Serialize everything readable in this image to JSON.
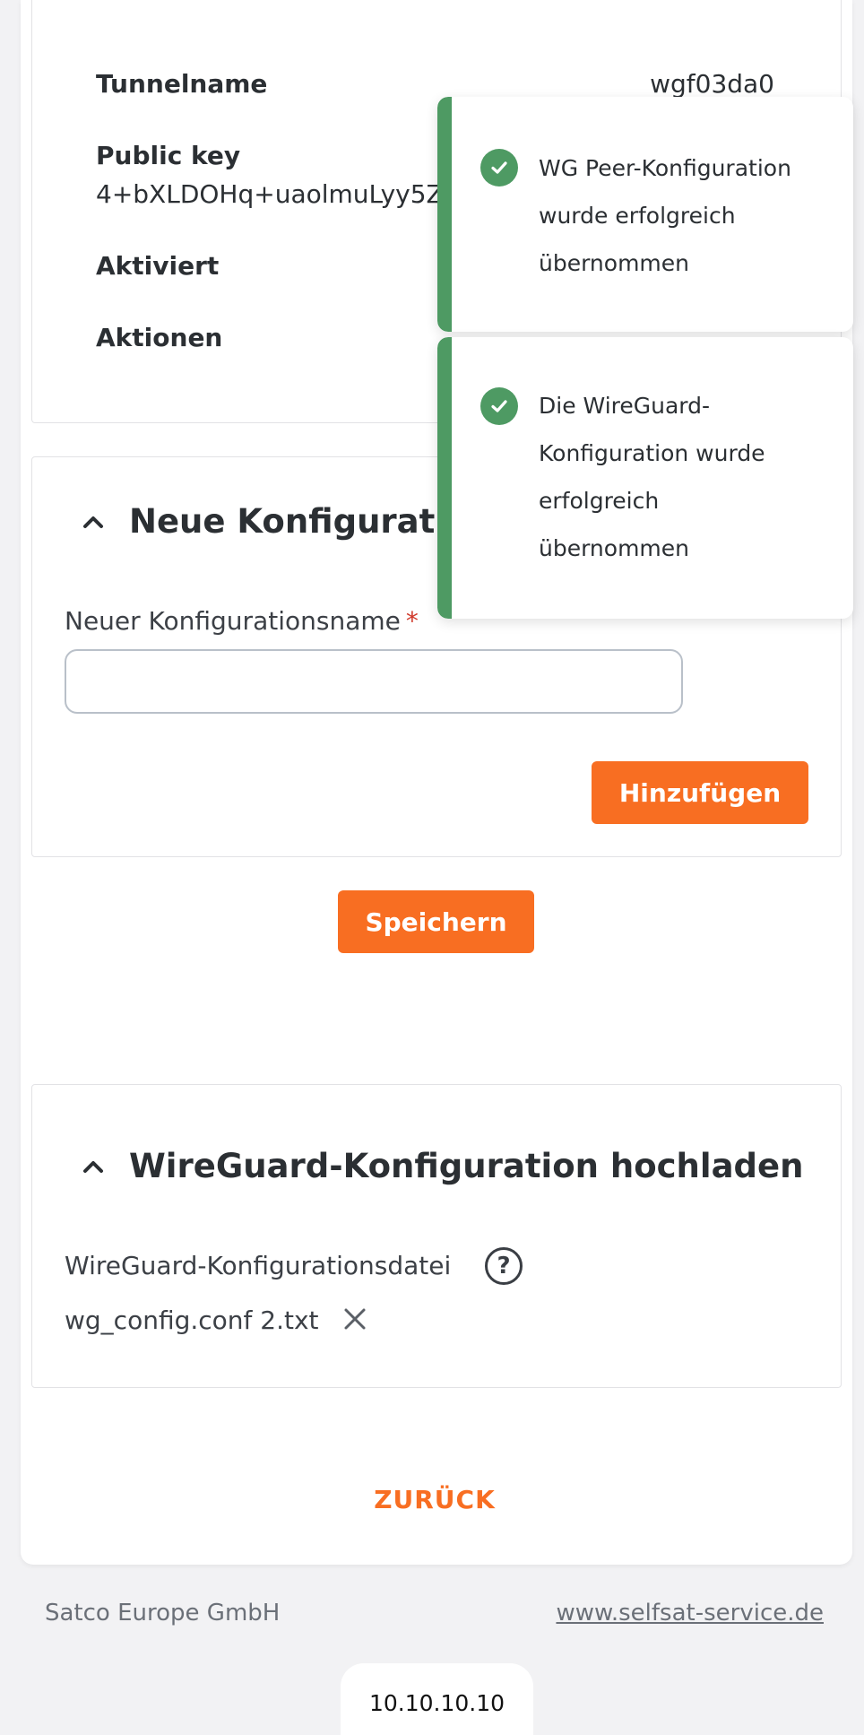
{
  "tunnel": {
    "name_label": "Tunnelname",
    "name_value": "wgf03da0",
    "public_key_label": "Public key",
    "public_key_value": "4+bXLDOHq+uaolmuLyy5Z",
    "activated_label": "Aktiviert",
    "actions_label": "Aktionen"
  },
  "new_config": {
    "title": "Neue Konfiguratio",
    "name_label": "Neuer Konfigurationsname",
    "required_mark": "*",
    "name_value": "",
    "add_button": "Hinzufügen"
  },
  "save_button": "Speichern",
  "upload": {
    "title": "WireGuard-Konfiguration hochladen",
    "file_label": "WireGuard-Konfigurationsdatei",
    "help_glyph": "?",
    "file_name": "wg_config.conf 2.txt"
  },
  "back_link": "ZURÜCK",
  "footer": {
    "company": "Satco Europe GmbH",
    "link": "www.selfsat-service.de"
  },
  "address_bar": "10.10.10.10",
  "toasts": [
    {
      "lines": [
        "WG Peer-Konfiguration",
        "wurde erfolgreich",
        "übernommen"
      ],
      "type": "success"
    },
    {
      "lines": [
        "Die WireGuard-",
        "Konfiguration wurde",
        "erfolgreich",
        "übernommen"
      ],
      "type": "success"
    }
  ],
  "colors": {
    "accent": "#f86e22",
    "success": "#4e9a63",
    "required": "#d0382a"
  },
  "icons": {
    "chevron": "chevron-up-icon",
    "check": "check-circle-icon",
    "help": "help-circle-icon",
    "remove": "close-icon"
  }
}
